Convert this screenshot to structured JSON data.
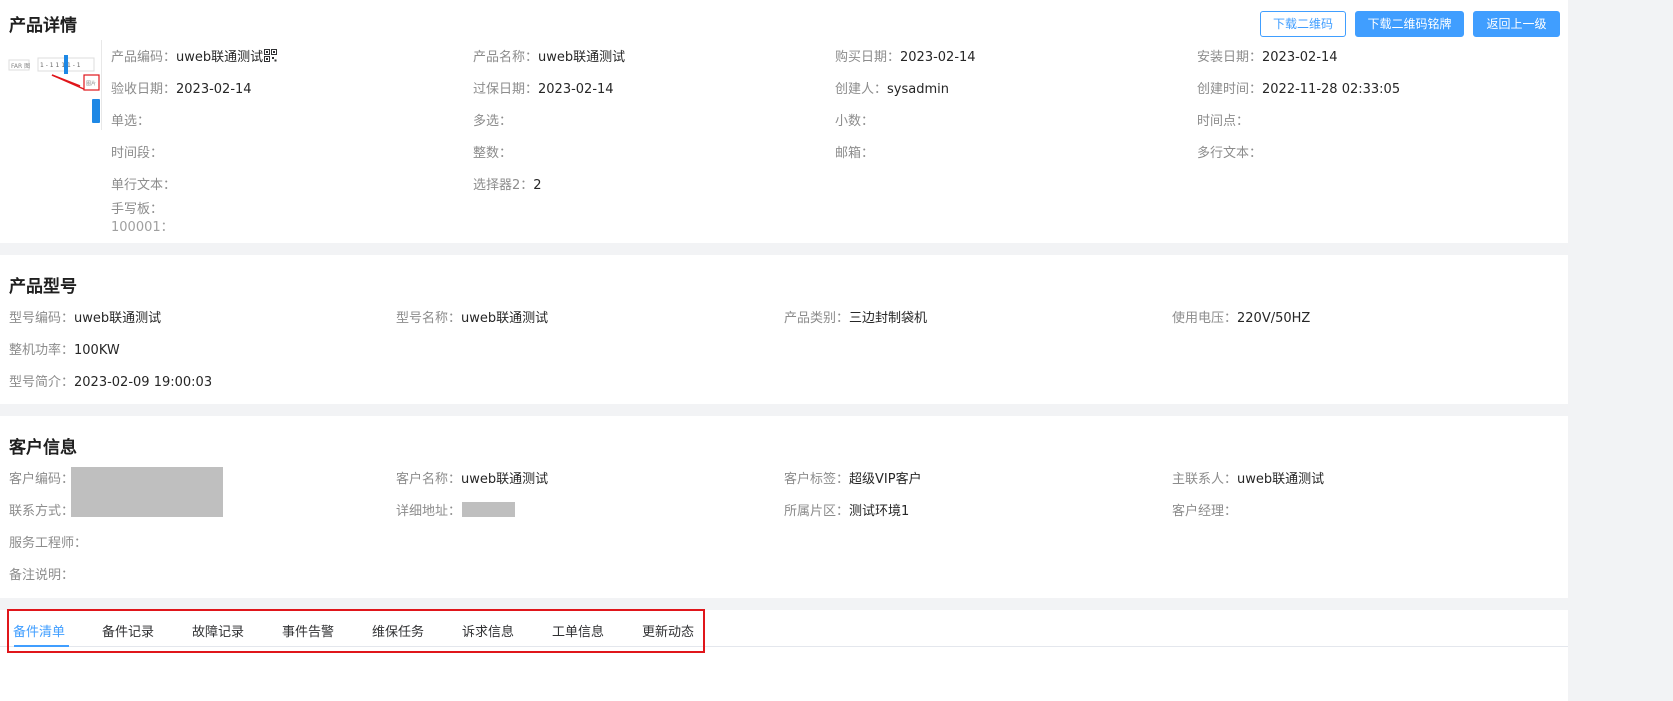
{
  "detail": {
    "title": "产品详情",
    "buttons": {
      "download_qr": "下载二维码",
      "download_qr_plate": "下载二维码铭牌",
      "back": "返回上一级"
    },
    "fields": [
      {
        "label": "产品编码：",
        "value": "uweb联通测试"
      },
      {
        "label": "产品名称：",
        "value": "uweb联通测试"
      },
      {
        "label": "购买日期：",
        "value": "2023-02-14"
      },
      {
        "label": "安装日期：",
        "value": "2023-02-14"
      },
      {
        "label": "验收日期：",
        "value": "2023-02-14"
      },
      {
        "label": "过保日期：",
        "value": "2023-02-14"
      },
      {
        "label": "创建人：",
        "value": "sysadmin"
      },
      {
        "label": "创建时间：",
        "value": "2022-11-28 02:33:05"
      },
      {
        "label": "单选：",
        "value": ""
      },
      {
        "label": "多选：",
        "value": ""
      },
      {
        "label": "小数：",
        "value": ""
      },
      {
        "label": "时间点：",
        "value": ""
      },
      {
        "label": "时间段：",
        "value": ""
      },
      {
        "label": "整数：",
        "value": ""
      },
      {
        "label": "邮箱：",
        "value": ""
      },
      {
        "label": "多行文本：",
        "value": ""
      },
      {
        "label": "单行文本：",
        "value": ""
      },
      {
        "label": "选择器2：",
        "value": "2"
      },
      {
        "label": "手写板：",
        "value": ""
      }
    ],
    "handwriting_value": "100001："
  },
  "model": {
    "title": "产品型号",
    "fields": [
      {
        "label": "型号编码：",
        "value": "uweb联通测试"
      },
      {
        "label": "型号名称：",
        "value": "uweb联通测试"
      },
      {
        "label": "产品类别：",
        "value": "三边封制袋机"
      },
      {
        "label": "使用电压：",
        "value": "220V/50HZ"
      },
      {
        "label": "整机功率：",
        "value": "100KW"
      },
      {
        "label": "型号简介：",
        "value": "2023-02-09 19:00:03"
      }
    ]
  },
  "customer": {
    "title": "客户信息",
    "fields": [
      {
        "label": "客户编码：",
        "value": ""
      },
      {
        "label": "客户名称：",
        "value": "uweb联通测试"
      },
      {
        "label": "客户标签：",
        "value": "超级VIP客户"
      },
      {
        "label": "主联系人：",
        "value": "uweb联通测试"
      },
      {
        "label": "联系方式：",
        "value": ""
      },
      {
        "label": "详细地址：",
        "value": ""
      },
      {
        "label": "所属片区：",
        "value": "测试环境1"
      },
      {
        "label": "客户经理：",
        "value": ""
      },
      {
        "label": "服务工程师：",
        "value": ""
      },
      {
        "label": "备注说明：",
        "value": ""
      }
    ]
  },
  "tabs": [
    {
      "label": "备件清单",
      "active": true
    },
    {
      "label": "备件记录"
    },
    {
      "label": "故障记录"
    },
    {
      "label": "事件告警"
    },
    {
      "label": "维保任务"
    },
    {
      "label": "诉求信息"
    },
    {
      "label": "工单信息"
    },
    {
      "label": "更新动态"
    }
  ],
  "colors": {
    "primary": "#409eff",
    "highlight": "#e0161b",
    "redacted": "#bfbfbf"
  }
}
